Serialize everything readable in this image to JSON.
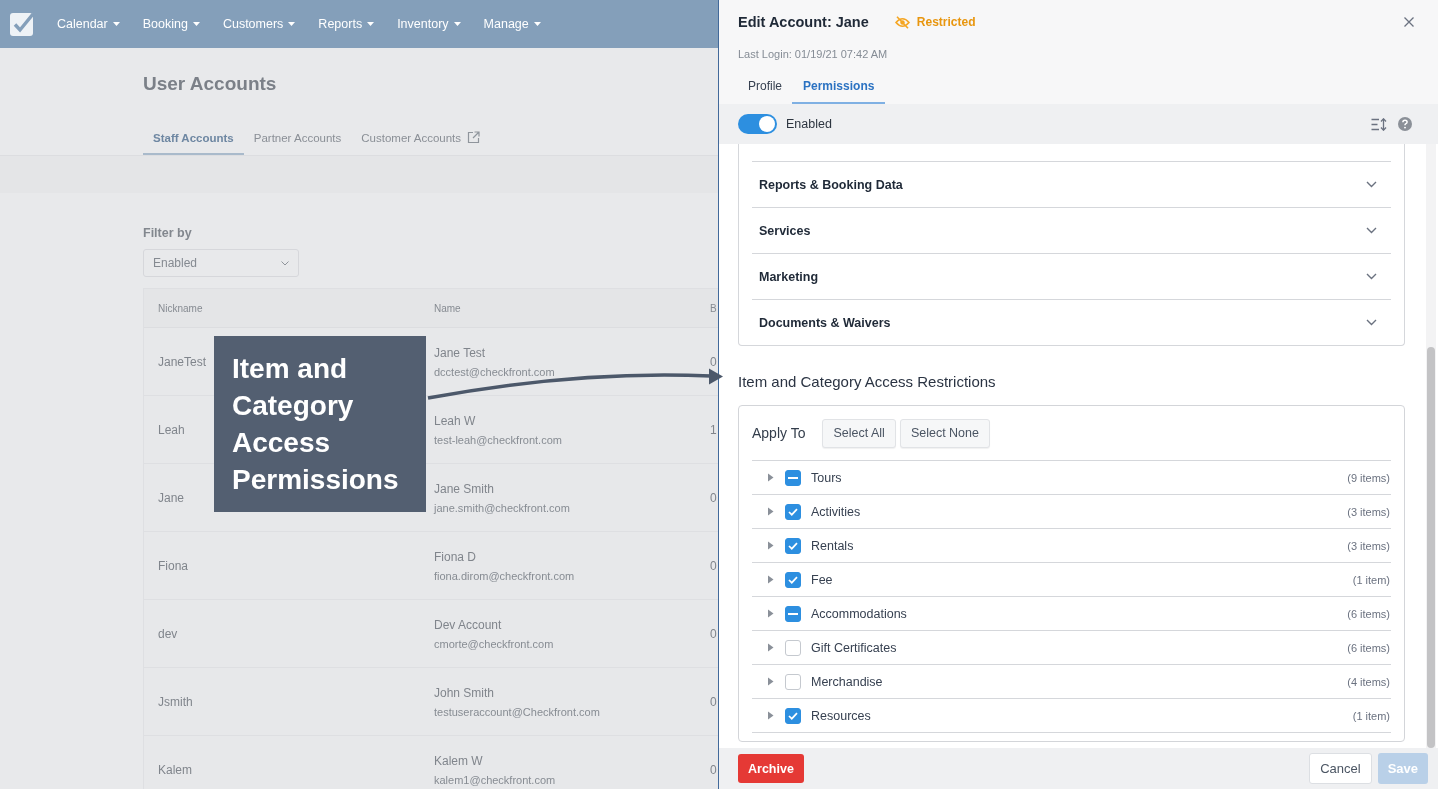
{
  "navbar": {
    "menu": [
      {
        "label": "Calendar"
      },
      {
        "label": "Booking"
      },
      {
        "label": "Customers"
      },
      {
        "label": "Reports"
      },
      {
        "label": "Inventory"
      },
      {
        "label": "Manage"
      }
    ]
  },
  "page": {
    "title": "User Accounts",
    "tabs": [
      {
        "label": "Staff Accounts",
        "selected": true,
        "external": false
      },
      {
        "label": "Partner Accounts",
        "selected": false,
        "external": false
      },
      {
        "label": "Customer Accounts",
        "selected": false,
        "external": true
      }
    ],
    "filter": {
      "label": "Filter by",
      "value": "Enabled"
    }
  },
  "table": {
    "columns": [
      "Nickname",
      "Name",
      "B"
    ],
    "rows": [
      {
        "nickname": "JaneTest",
        "name": "Jane Test",
        "email": "dcctest@checkfront.com",
        "column_3": "0"
      },
      {
        "nickname": "Leah",
        "name": "Leah W",
        "email": "test-leah@checkfront.com",
        "column_3": "1"
      },
      {
        "nickname": "Jane",
        "name": "Jane Smith",
        "email": "jane.smith@checkfront.com",
        "column_3": "0"
      },
      {
        "nickname": "Fiona",
        "name": "Fiona D",
        "email": "fiona.dirom@checkfront.com",
        "column_3": "0"
      },
      {
        "nickname": "dev",
        "name": "Dev Account",
        "email": "cmorte@checkfront.com",
        "column_3": "0"
      },
      {
        "nickname": "Jsmith",
        "name": "John Smith",
        "email": "testuseraccount@Checkfront.com",
        "column_3": "0"
      },
      {
        "nickname": "Kalem",
        "name": "Kalem W",
        "email": "kalem1@checkfront.com",
        "column_3": "0"
      }
    ]
  },
  "callout": {
    "text": "Item and Category Access Permissions"
  },
  "panel": {
    "title": "Edit Account: Jane",
    "status": {
      "label": "Restricted"
    },
    "last_login": "Last Login: 01/19/21 07:42 AM",
    "tabs": [
      {
        "label": "Profile",
        "selected": false
      },
      {
        "label": "Permissions",
        "selected": true
      }
    ],
    "enabled_toggle": {
      "label": "Enabled",
      "on": true
    },
    "sections": [
      {
        "label": "Reports & Booking Data",
        "expanded": false
      },
      {
        "label": "Services",
        "expanded": false
      },
      {
        "label": "Marketing",
        "expanded": false
      },
      {
        "label": "Documents & Waivers",
        "expanded": false
      }
    ],
    "restrictions": {
      "title": "Item and Category Access Restrictions",
      "apply_to": "Apply To",
      "buttons": [
        {
          "label": "Select All"
        },
        {
          "label": "Select None"
        }
      ],
      "categories": [
        {
          "label": "Tours",
          "count": "(9 items)",
          "checked": true,
          "indeterminate": true,
          "expanded": false
        },
        {
          "label": "Activities",
          "count": "(3 items)",
          "checked": true,
          "indeterminate": false,
          "expanded": false
        },
        {
          "label": "Rentals",
          "count": "(3 items)",
          "checked": true,
          "indeterminate": false,
          "expanded": false
        },
        {
          "label": "Fee",
          "count": "(1 item)",
          "checked": true,
          "indeterminate": false,
          "expanded": false
        },
        {
          "label": "Accommodations",
          "count": "(6 items)",
          "checked": true,
          "indeterminate": true,
          "expanded": false
        },
        {
          "label": "Gift Certificates",
          "count": "(6 items)",
          "checked": false,
          "indeterminate": false,
          "expanded": false
        },
        {
          "label": "Merchandise",
          "count": "(4 items)",
          "checked": false,
          "indeterminate": false,
          "expanded": false
        },
        {
          "label": "Resources",
          "count": "(1 item)",
          "checked": true,
          "indeterminate": false,
          "expanded": false
        }
      ]
    },
    "footer": {
      "buttons": [
        {
          "label": "Archive",
          "kind": "danger",
          "disabled": false
        },
        {
          "label": "Cancel",
          "kind": "default",
          "disabled": false
        },
        {
          "label": "Save",
          "kind": "primary",
          "disabled": true
        }
      ]
    }
  }
}
